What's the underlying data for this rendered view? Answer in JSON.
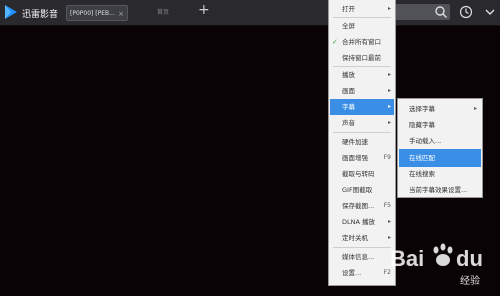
{
  "app": {
    "title": "迅雷影音"
  },
  "tabs": [
    {
      "label": "[P0P00] [PEB...",
      "close": "×"
    },
    {
      "label": "首页"
    }
  ],
  "new_tab": "+",
  "icons": {
    "logo": "logo-icon",
    "search": "search-icon",
    "history": "clock-icon",
    "more": "chevron-down-icon"
  },
  "context_menu": {
    "items": [
      {
        "label": "打开",
        "arrow": "▸"
      },
      {
        "label": "全屏"
      },
      {
        "label": "合并所有窗口",
        "checked": true
      },
      {
        "label": "保持窗口最前"
      },
      {
        "label": "播放",
        "arrow": "▸"
      },
      {
        "label": "画面",
        "arrow": "▸"
      },
      {
        "label": "字幕",
        "arrow": "▸"
      },
      {
        "label": "声音",
        "arrow": "▸"
      },
      {
        "label": "硬件加速"
      },
      {
        "label": "画面增强",
        "shortcut": "F9"
      },
      {
        "label": "截取与转码"
      },
      {
        "label": "GIF图截取"
      },
      {
        "label": "保存截图...",
        "shortcut": "F5"
      },
      {
        "label": "DLNA 播放",
        "arrow": "▸"
      },
      {
        "label": "定时关机",
        "arrow": "▸"
      },
      {
        "label": "媒体信息..."
      },
      {
        "label": "设置...",
        "shortcut": "F2"
      }
    ]
  },
  "subtitle_menu": {
    "items": [
      {
        "label": "选择字幕",
        "arrow": "▸"
      },
      {
        "label": "隐藏字幕"
      },
      {
        "label": "手动载入..."
      },
      {
        "label": "在线匹配"
      },
      {
        "label": "在线搜索"
      },
      {
        "label": "当前字幕效果设置..."
      }
    ]
  },
  "colors": {
    "highlight": "#3a8ee6",
    "background": "#0a0306",
    "topbar": "#2a2a2e"
  },
  "watermark": {
    "brand": "Bai",
    "suffix": "du",
    "sub": "经验"
  }
}
